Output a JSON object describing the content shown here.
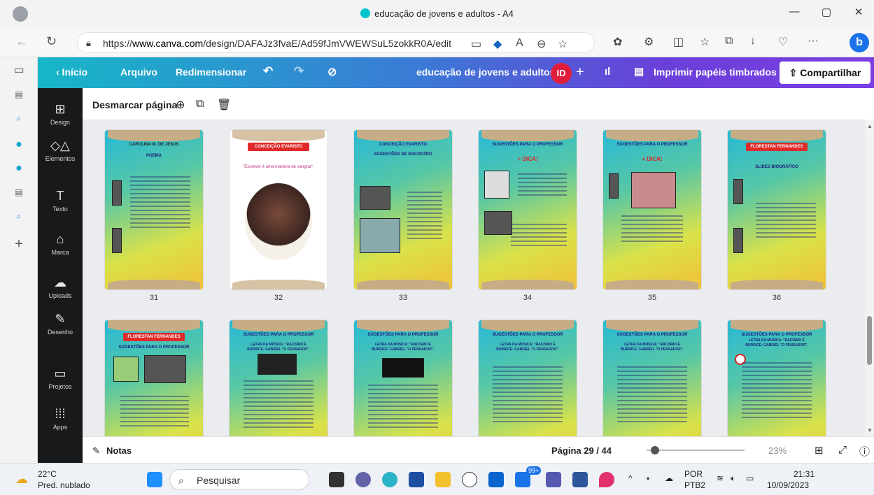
{
  "window": {
    "title": "educação de jovens e adultos - A4"
  },
  "browser": {
    "url_prefix": "https://",
    "url_domain": "www.canva.com",
    "url_path": "/design/DAFAJz3fvaE/Ad59fJmVWEWSuL5zokkR0A/edit"
  },
  "canva_header": {
    "back_label": "‹  Início",
    "file_label": "Arquivo",
    "resize_label": "Redimensionar",
    "doc_title": "educação de jovens e adultos",
    "user_initials": "ID",
    "print_label": "Imprimir papéis timbrados",
    "share_label": "Compartilhar"
  },
  "sidebar": {
    "items": [
      {
        "label": "Design",
        "icon": "layout-icon"
      },
      {
        "label": "Elementos",
        "icon": "shapes-icon"
      },
      {
        "label": "Texto",
        "icon": "text-icon"
      },
      {
        "label": "Marca",
        "icon": "brand-icon"
      },
      {
        "label": "Uploads",
        "icon": "upload-icon"
      },
      {
        "label": "Desenho",
        "icon": "draw-icon"
      },
      {
        "label": "Projetos",
        "icon": "folder-icon"
      },
      {
        "label": "Apps",
        "icon": "apps-icon"
      }
    ]
  },
  "pagebar": {
    "deselect_label": "Desmarcar página"
  },
  "pages_row1": [
    {
      "number": "31",
      "title": "CAROLINA M. DE JESUS",
      "sub": "POEMA"
    },
    {
      "number": "32",
      "title": "CONCEIÇÃO EVARISTO",
      "sub": "\"Escrever é uma maneira de sangrar\"."
    },
    {
      "number": "33",
      "title": "CONCEIÇÃO EVARISTO",
      "sub": "SUGESTÕES DE ENCONTRO"
    },
    {
      "number": "34",
      "title": "SUGESTÕES PARA O PROFESSOR",
      "sub": "+ DICA!"
    },
    {
      "number": "35",
      "title": "SUGESTÕES PARA O PROFESSOR",
      "sub": "+ DICA!"
    },
    {
      "number": "36",
      "title": "FLORESTAN FERNANDES",
      "sub": "SLIDES BIOGRÁFICO"
    }
  ],
  "pages_row2": [
    {
      "title": "FLORESTAN FERNANDES",
      "sub": "SUGESTÕES PARA O PROFESSOR"
    },
    {
      "title": "SUGESTÕES PARA O PROFESSOR",
      "sub": "LETRA DA MÚSICA: \"RACISMO É BURRICE: GABRIEL \"O PENSADOR\"."
    },
    {
      "title": "SUGESTÕES PARA O PROFESSOR",
      "sub": "LETRA DA MÚSICA: \"RACISMO É BURRICE: GABRIEL \"O PENSADOR\"."
    },
    {
      "title": "SUGESTÕES PARA O PROFESSOR",
      "sub": "LETRA DA MÚSICA: \"RACISMO É BURRICE: GABRIEL \"O PENSADOR\"."
    },
    {
      "title": "SUGESTÕES PARA O PROFESSOR",
      "sub": "LETRA DA MÚSICA: \"RACISMO É BURRICE: GABRIEL \"O PENSADOR\"."
    },
    {
      "title": "SUGESTÕES PARA O PROFESSOR",
      "sub": "LETRA DA MÚSICA: \"RACISMO É BURRICE: GABRIEL \"O PENSADOR\"."
    }
  ],
  "bottombar": {
    "notes_label": "Notas",
    "page_indicator": "Página 29 / 44",
    "zoom": "23%",
    "zoom_fraction": 0.23
  },
  "taskbar": {
    "temp": "22°C",
    "weather": "Pred. nublado",
    "search_placeholder": "Pesquisar",
    "lang1": "POR",
    "lang2": "PTB2",
    "time": "21:31",
    "date": "10/09/2023",
    "badge": "99+"
  }
}
